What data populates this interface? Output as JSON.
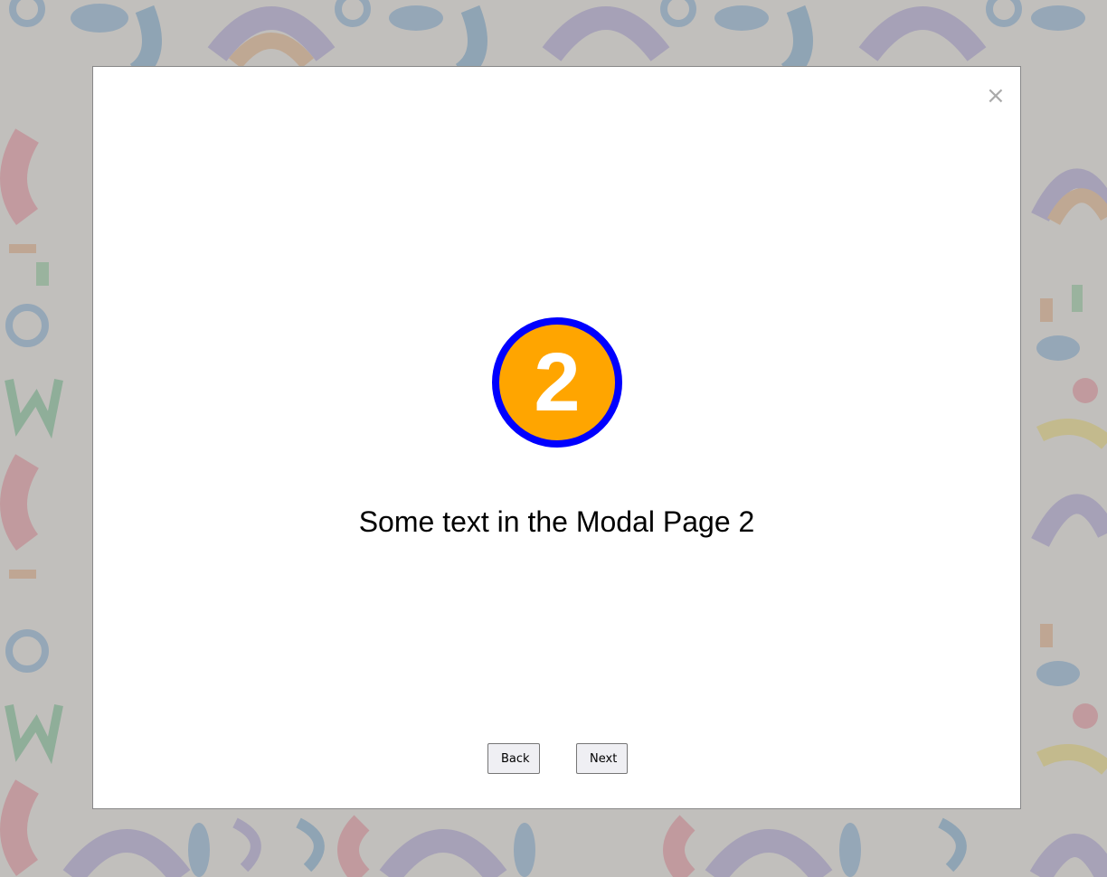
{
  "modal": {
    "step_number": "2",
    "text": "Some text in the Modal Page 2",
    "close_glyph": "×",
    "back_label": "Back",
    "next_label": "Next"
  },
  "colors": {
    "badge_fill": "#ffa500",
    "badge_border": "#0000ff",
    "badge_text": "#ffffff"
  },
  "icons": {
    "close": "close-icon"
  }
}
